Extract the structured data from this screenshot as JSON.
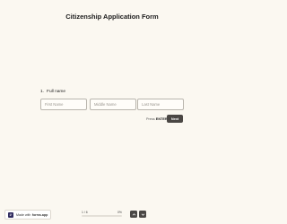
{
  "form": {
    "title": "Citizenship Application Form"
  },
  "question": {
    "number": "1.",
    "label": "Full name",
    "fields": [
      {
        "placeholder": "First Name"
      },
      {
        "placeholder": "Middle Name"
      },
      {
        "placeholder": "Last Name"
      }
    ]
  },
  "actions": {
    "press_label": "Press",
    "press_key": "ENTER",
    "next_label": "Next"
  },
  "footer": {
    "badge_prefix": "Made with",
    "badge_brand": "forms.app",
    "progress_text": "1 / 6",
    "progress_percent_text": "0%",
    "progress_value": 0
  },
  "colors": {
    "background": "#fbf8f1",
    "accent": "#4a4744"
  },
  "icons": {
    "up": "chevron-up-icon",
    "down": "chevron-down-icon",
    "logo": "forms-app-logo-icon"
  }
}
